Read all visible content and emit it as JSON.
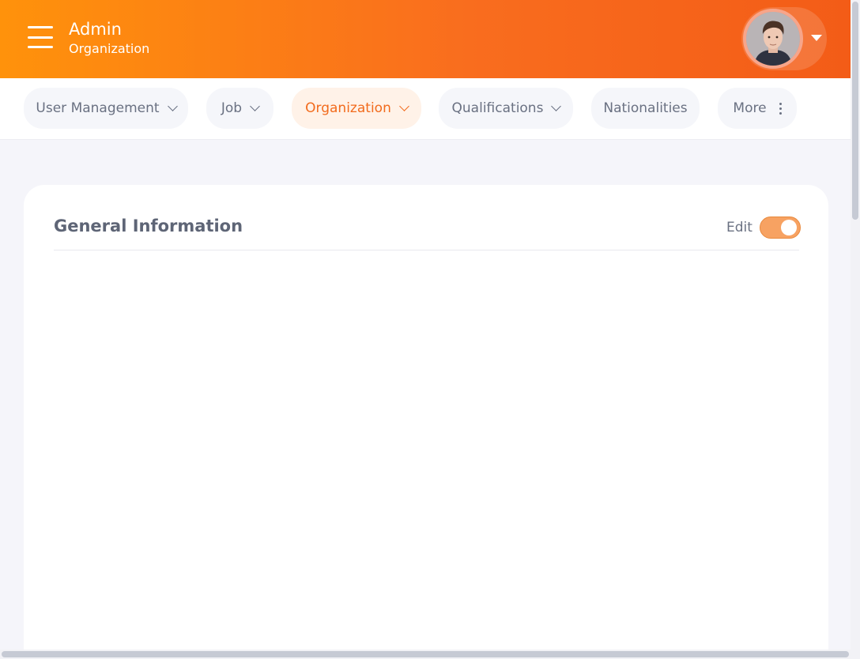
{
  "header": {
    "title": "Admin",
    "subtitle": "Organization",
    "menu_icon": "hamburger-icon",
    "user_menu_icon": "caret-down-icon"
  },
  "tabs": [
    {
      "label": "User Management",
      "has_dropdown": true,
      "active": false
    },
    {
      "label": "Job",
      "has_dropdown": true,
      "active": false
    },
    {
      "label": "Organization",
      "has_dropdown": true,
      "active": true
    },
    {
      "label": "Qualifications",
      "has_dropdown": true,
      "active": false
    },
    {
      "label": "Nationalities",
      "has_dropdown": false,
      "active": false
    },
    {
      "label": "More",
      "has_dropdown": false,
      "active": false,
      "icon": "kebab-icon"
    }
  ],
  "card": {
    "title": "General Information",
    "edit_label": "Edit",
    "edit_enabled": true
  },
  "colors": {
    "brand_start": "#ff920b",
    "brand_end": "#f35c17",
    "active_tab_text": "#f26b1d",
    "active_tab_bg": "#fff2e8",
    "toggle_on": "#f7a262"
  }
}
